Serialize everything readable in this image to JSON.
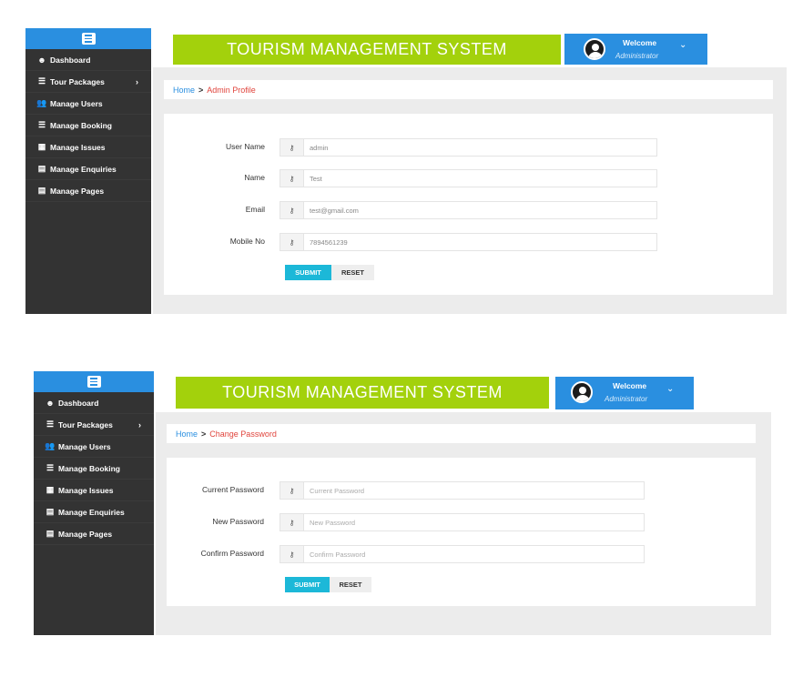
{
  "app": {
    "title": "TOURISM MANAGEMENT SYSTEM",
    "welcome": "Welcome",
    "role": "Administrator",
    "caret": "⌄"
  },
  "sidebar": {
    "items": [
      {
        "label": "Dashboard",
        "icon": "dashboard-icon",
        "glyph": "☻"
      },
      {
        "label": "Tour Packages",
        "icon": "list-icon",
        "glyph": "☰",
        "chevron": "›"
      },
      {
        "label": "Manage Users",
        "icon": "users-icon",
        "glyph": "👥"
      },
      {
        "label": "Manage Booking",
        "icon": "list-icon",
        "glyph": "☰"
      },
      {
        "label": "Manage Issues",
        "icon": "table-icon",
        "glyph": "▦"
      },
      {
        "label": "Manage Enquiries",
        "icon": "file-icon",
        "glyph": "▤"
      },
      {
        "label": "Manage Pages",
        "icon": "file-icon",
        "glyph": "▤"
      }
    ]
  },
  "profile": {
    "breadcrumb": {
      "home": "Home",
      "sep": ">",
      "current": "Admin Profile"
    },
    "fields": [
      {
        "label": "User Name",
        "value": "admin"
      },
      {
        "label": "Name",
        "value": "Test"
      },
      {
        "label": "Email",
        "value": "test@gmail.com"
      },
      {
        "label": "Mobile No",
        "value": "7894561239"
      }
    ],
    "submit": "SUBMIT",
    "reset": "RESET"
  },
  "password": {
    "breadcrumb": {
      "home": "Home",
      "sep": ">",
      "current": "Change Password"
    },
    "fields": [
      {
        "label": "Current Password",
        "placeholder": "Current Password"
      },
      {
        "label": "New Password",
        "placeholder": "New Password"
      },
      {
        "label": "Confirm Password",
        "placeholder": "Confirm Password"
      }
    ],
    "submit": "SUBMIT",
    "reset": "RESET"
  },
  "colors": {
    "sidebar": "#333333",
    "accent_blue": "#2a8fe0",
    "title_green": "#a3d10c",
    "submit": "#1cb8d8",
    "breadcrumb_current": "#e0443c"
  }
}
